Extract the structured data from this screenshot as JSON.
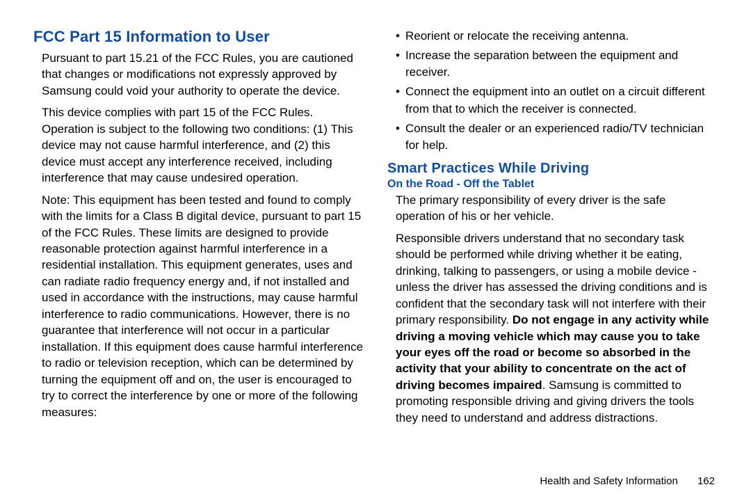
{
  "left": {
    "heading1": "FCC Part 15 Information to User",
    "p1": "Pursuant to part 15.21 of the FCC Rules, you are cautioned that changes or modifications not expressly approved by Samsung could void your authority to operate the device.",
    "p2": "This device complies with part 15 of the FCC Rules. Operation is subject to the following two conditions: (1) This device may not cause harmful interference, and (2) this device must accept any interference received, including interference that may cause undesired operation.",
    "p3": "Note: This equipment has been tested and found to comply with the limits for a Class B digital device, pursuant to part 15 of the FCC Rules. These limits are designed to provide reasonable protection against harmful interference in a residential installation. This equipment generates, uses and can radiate radio frequency energy and, if not installed and used in accordance with the instructions, may cause harmful interference to radio communications. However, there is no guarantee that interference will not occur in a particular installation. If this equipment does cause harmful interference to radio or television reception, which can be determined by turning the equipment off and on, the user is encouraged to try to correct the interference by one or more of the following measures:"
  },
  "right": {
    "bullets": [
      "Reorient or relocate the receiving antenna.",
      "Increase the separation between the equipment and receiver.",
      "Connect the equipment into an outlet on a circuit different from that to which the receiver is connected.",
      "Consult the dealer or an experienced radio/TV technician for help."
    ],
    "heading2": "Smart Practices While Driving",
    "subheading": "On the Road - Off the Tablet",
    "p4": "The primary responsibility of every driver is the safe operation of his or her vehicle.",
    "p5a": "Responsible drivers understand that no secondary task should be performed while driving whether it be eating, drinking, talking to passengers, or using a mobile device - unless the driver has assessed the driving conditions and is confident that the secondary task will not interfere with their primary responsibility. ",
    "p5bold": "Do not engage in any activity while driving a moving vehicle which may cause you to take your eyes off the road or become so absorbed in the activity that your ability to concentrate on the act of driving becomes impaired",
    "p5b": ". Samsung is committed to promoting responsible driving and giving drivers the tools they need to understand and address distractions."
  },
  "footer": {
    "section": "Health and Safety Information",
    "page": "162"
  }
}
